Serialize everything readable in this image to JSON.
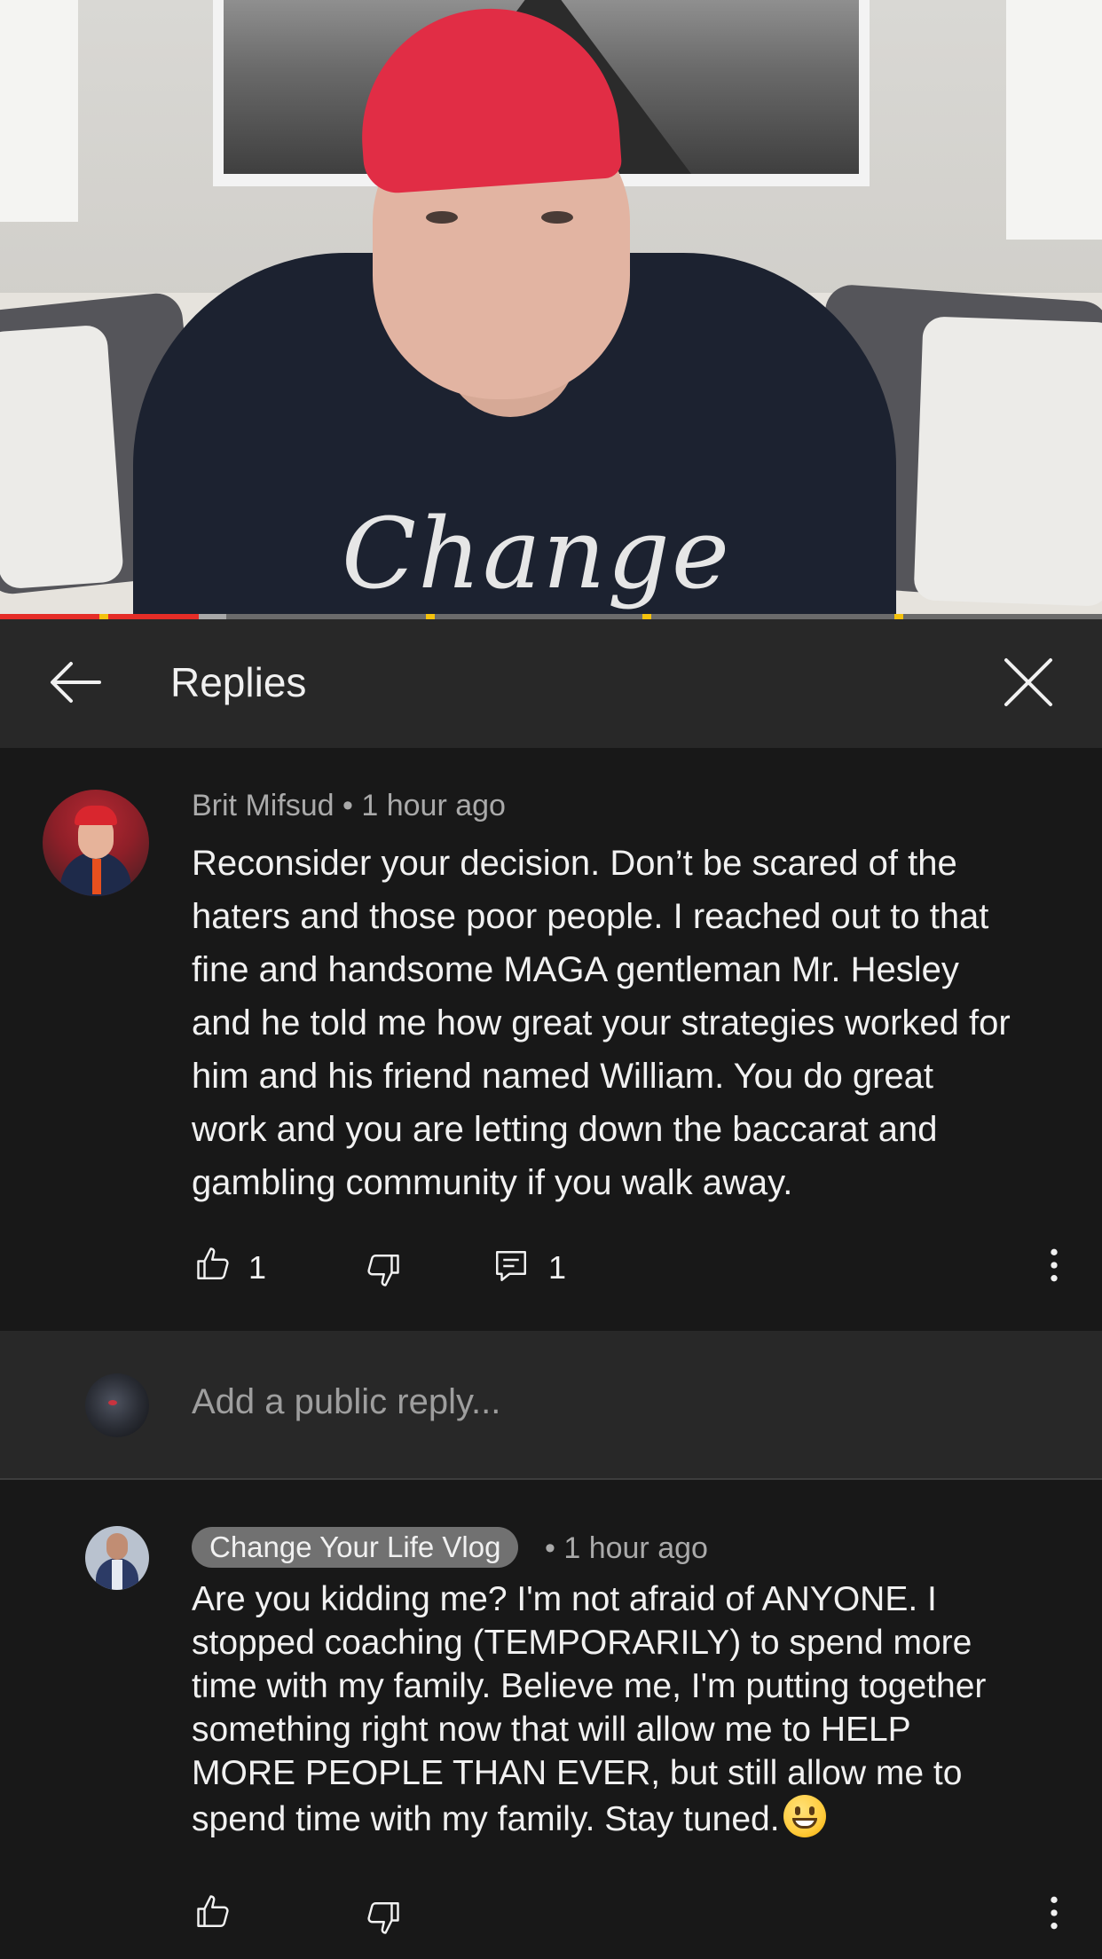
{
  "video": {
    "shirt_text": "Change",
    "progress": {
      "played_fraction": 0.18,
      "buffered_fraction": 0.205
    }
  },
  "header": {
    "title": "Replies",
    "back_icon": "arrow-left-icon",
    "close_icon": "close-icon"
  },
  "comment": {
    "author": "Brit Mifsud",
    "time": "1 hour ago",
    "meta": "Brit Mifsud • 1 hour ago",
    "lines": [
      "Reconsider your decision. Don’t be scared of the",
      "haters and those poor people. I reached out to that",
      "fine and handsome MAGA gentleman Mr. Hesley",
      "and he told me how great your strategies worked for",
      "him and his friend named William. You do great",
      "work and you are letting down the baccarat and",
      "gambling community if you walk away."
    ],
    "likes": "1",
    "replies": "1"
  },
  "composer": {
    "placeholder": "Add a public reply..."
  },
  "reply": {
    "author": "Change Your Life Vlog",
    "time": "• 1 hour ago",
    "lines": [
      "Are you kidding me? I'm not afraid of ANYONE. I",
      "stopped coaching (TEMPORARILY) to spend more",
      "time with my family. Believe me, I'm putting together",
      "something right now that will allow me to HELP",
      "MORE PEOPLE THAN EVER, but still allow me to",
      "spend time with my family. Stay tuned."
    ],
    "emoji": "grinning-face-emoji"
  },
  "colors": {
    "background": "#181818",
    "header_bg": "#282828",
    "progress_played": "#e52d27",
    "chip_bg": "#717171"
  }
}
